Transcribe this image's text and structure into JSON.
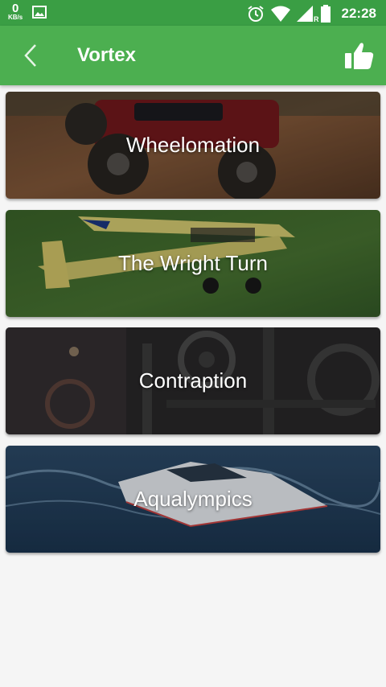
{
  "status_bar": {
    "net_speed_value": "0",
    "net_speed_unit": "KB/s",
    "roaming_indicator": "R",
    "time": "22:28",
    "icons": [
      "image-icon",
      "alarm-icon",
      "wifi-icon",
      "signal-icon",
      "battery-icon"
    ]
  },
  "app_bar": {
    "title": "Vortex",
    "back_icon": "chevron-left-icon",
    "action_icon": "thumbs-up-icon"
  },
  "events": [
    {
      "label": "Wheelomation",
      "image": "rc-monster-truck"
    },
    {
      "label": "The Wright Turn",
      "image": "rc-airplane"
    },
    {
      "label": "Contraption",
      "image": "machine-gears"
    },
    {
      "label": "Aqualympics",
      "image": "rc-speedboat"
    }
  ],
  "colors": {
    "status_bar": "#3a9e44",
    "app_bar": "#4caf50",
    "background": "#f5f5f5",
    "text_on_primary": "#ffffff"
  }
}
